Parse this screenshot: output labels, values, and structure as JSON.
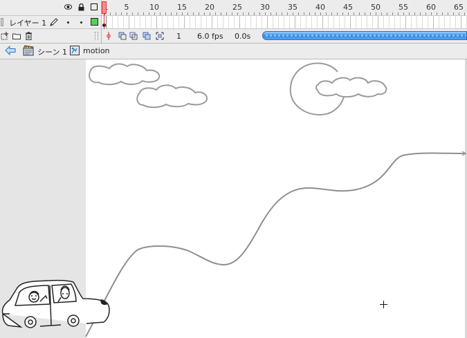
{
  "timeline": {
    "ruler_labels": [
      "1",
      "5",
      "10",
      "15",
      "20",
      "25",
      "30",
      "35",
      "40",
      "45",
      "50",
      "55",
      "60",
      "65"
    ],
    "layer": {
      "name": "レイヤー 1",
      "color": "#4fd34f"
    },
    "status": {
      "frame": "1",
      "fps": "6.0 fps",
      "time": "0.0s"
    }
  },
  "editbar": {
    "scene_label": "シーン 1",
    "symbol_label": "motion"
  },
  "stage": {
    "background": "#ffffff"
  },
  "icons": {
    "header": [
      "eye-icon",
      "lock-icon",
      "outline-icon"
    ],
    "layer": [
      "pencil-icon",
      "visibility-dot",
      "lock-dot",
      "outline-color-box"
    ],
    "bottom": [
      "add-layer-icon",
      "add-folder-icon",
      "trash-icon"
    ],
    "status": [
      "center-frame-icon",
      "onion-skin-icon",
      "onion-skin-outlines-icon",
      "edit-multiple-frames-icon",
      "modify-markers-icon"
    ],
    "editbar": [
      "back-arrow-icon",
      "scene-icon",
      "symbol-icon"
    ]
  }
}
